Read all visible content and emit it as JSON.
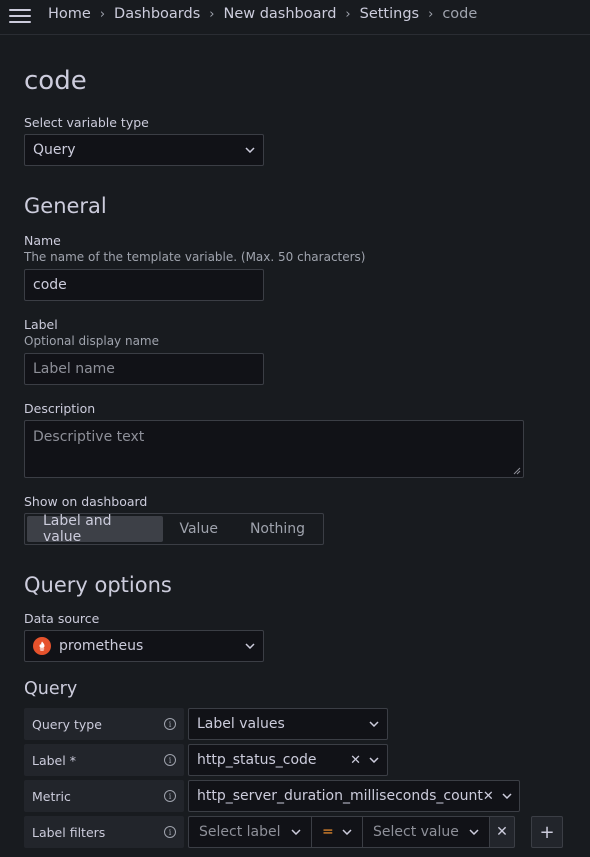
{
  "breadcrumb": {
    "items": [
      "Home",
      "Dashboards",
      "New dashboard",
      "Settings"
    ],
    "current": "code"
  },
  "page": {
    "title": "code"
  },
  "variable_type": {
    "label": "Select variable type",
    "value": "Query"
  },
  "general": {
    "heading": "General",
    "name": {
      "label": "Name",
      "description": "The name of the template variable. (Max. 50 characters)",
      "value": "code"
    },
    "label": {
      "label": "Label",
      "description": "Optional display name",
      "placeholder": "Label name"
    },
    "description": {
      "label": "Description",
      "placeholder": "Descriptive text"
    },
    "show_on_dashboard": {
      "label": "Show on dashboard",
      "options": [
        "Label and value",
        "Value",
        "Nothing"
      ],
      "selected": "Label and value"
    }
  },
  "query_options": {
    "heading": "Query options",
    "data_source": {
      "label": "Data source",
      "value": "prometheus",
      "color": "#e6522c"
    }
  },
  "query": {
    "heading": "Query",
    "rows": {
      "query_type": {
        "label": "Query type",
        "value": "Label values"
      },
      "label": {
        "label": "Label *",
        "value": "http_status_code"
      },
      "metric": {
        "label": "Metric",
        "value": "http_server_duration_milliseconds_count"
      },
      "label_filters": {
        "label": "Label filters",
        "label_placeholder": "Select label",
        "operator": "=",
        "value_placeholder": "Select value"
      }
    }
  },
  "colors": {
    "background": "#181b1f",
    "field": "#111217",
    "border": "#3b3e45",
    "operator": "#ff9830"
  }
}
